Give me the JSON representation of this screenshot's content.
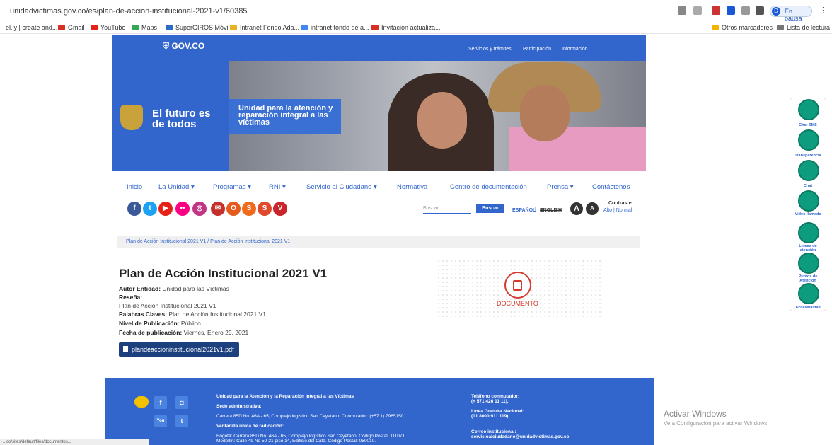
{
  "browser": {
    "url": "unidadvictimas.gov.co/es/plan-de-accion-institucional-2021-v1/60385",
    "profile_initial": "D",
    "profile_status": "En pausa",
    "bookmarks": [
      "el.ly | create and...",
      "Gmail",
      "YouTube",
      "Maps",
      "SuperGIROS Móvil",
      "Intranet Fondo Ada...",
      "intranet fondo de a...",
      "Invitación actualiza..."
    ],
    "other_bookmarks": "Otros marcadores",
    "reading_list": "Lista de lectura",
    "status_url": "...co/sites/default/files/documentos..."
  },
  "gov": {
    "logo": "GOV.CO",
    "links": [
      "Servicios y trámites",
      "Participación",
      "Información"
    ]
  },
  "hero": {
    "slogan": "El futuro es de todos",
    "entity": "Unidad para la atención y reparación integral a las víctimas"
  },
  "nav": {
    "items": [
      "Inicio",
      "La Unidad ▾",
      "Programas ▾",
      "RNI ▾",
      "Servicio al Ciudadano ▾",
      "Normativa",
      "Centro de documentación",
      "Prensa ▾",
      "Contáctenos"
    ],
    "search_placeholder": "Buscar",
    "search_button": "Buscar",
    "lang_es": "ESPAÑOL",
    "lang_sep": "|",
    "lang_en": "ENGLISH",
    "contrast_label": "Contraste:",
    "contrast_options": "Alto  |  Normal",
    "a_big": "A",
    "a_small": "A"
  },
  "social": [
    {
      "icon": "facebook-icon",
      "glyph": "f",
      "color": "#3b5998"
    },
    {
      "icon": "twitter-icon",
      "glyph": "t",
      "color": "#1da1f2"
    },
    {
      "icon": "youtube-icon",
      "glyph": "▶",
      "color": "#e62117"
    },
    {
      "icon": "flickr-icon",
      "glyph": "••",
      "color": "#ff0084"
    },
    {
      "icon": "instagram-icon",
      "glyph": "◎",
      "color": "#c13584"
    },
    {
      "icon": "mail-icon",
      "glyph": "✉",
      "color": "#c4302b"
    },
    {
      "icon": "o-icon",
      "glyph": "O",
      "color": "#e65a1b"
    },
    {
      "icon": "s-icon",
      "glyph": "S",
      "color": "#f06a1b"
    },
    {
      "icon": "s2-icon",
      "glyph": "S",
      "color": "#e0492c"
    },
    {
      "icon": "v-icon",
      "glyph": "V",
      "color": "#c8262c"
    }
  ],
  "breadcrumb": "Plan de Acción Institucional 2021 V1  /  Plan de Acción Institucional 2021 V1",
  "document": {
    "title": "Plan de Acción Institucional 2021 V1",
    "autor_label": "Autor Entidad:",
    "autor": "Unidad para las Víctimas",
    "resena_label": "Reseña:",
    "resena": "Plan de Acción Institucional 2021 V1",
    "palabras_label": "Palabras Claves:",
    "palabras": "Plan de Acción Institucional 2021 V1",
    "nivel_label": "Nivel de Publicación:",
    "nivel": "Público",
    "fecha_label": "Fecha de publicación:",
    "fecha": "Viernes, Enero 29, 2021",
    "pdf": "plandeaccioninstitucional2021v1.pdf",
    "card_label": "DOCUMENTO"
  },
  "footer": {
    "org": "Unidad para la Atención y la Reparación Integral a las Víctimas",
    "sede_label": "Sede administrativa:",
    "sede": "Carrera 85D No. 46A - 65, Complejo logístico San Cayetano. Conmutador: (+57 1) 7965150.",
    "ventanilla_label": "Ventanilla única de radicación:",
    "ventanilla1": "Bogotá: Carrera 85D No. 46A - 65, Complejo logístico San Cayetano. Código Postal: 111071.",
    "ventanilla2": "Medellín: Calle 49 No 50-21 piso 14, Edificio del Café. Código Postal: 050010.",
    "tel_label": "Teléfono conmutador:",
    "tel": "(+ 571 426 11 11).",
    "linea_label": "Línea Gratuita Nacional:",
    "linea": "(01 8000 911 119).",
    "correo_label": "Correo institucional:",
    "correo": "servicioalciudadano@unidadvictimas.gov.co",
    "social": [
      "f",
      "◘",
      "You",
      "t"
    ]
  },
  "windows": {
    "line1": "Activar Windows",
    "line2": "Ve a Configuración para activar Windows."
  },
  "side_widget": [
    "Chat SMS",
    "Transparencia",
    "Chat",
    "Video llamada",
    "Líneas de atención",
    "Puntos de Atención",
    "Accesibilidad"
  ]
}
